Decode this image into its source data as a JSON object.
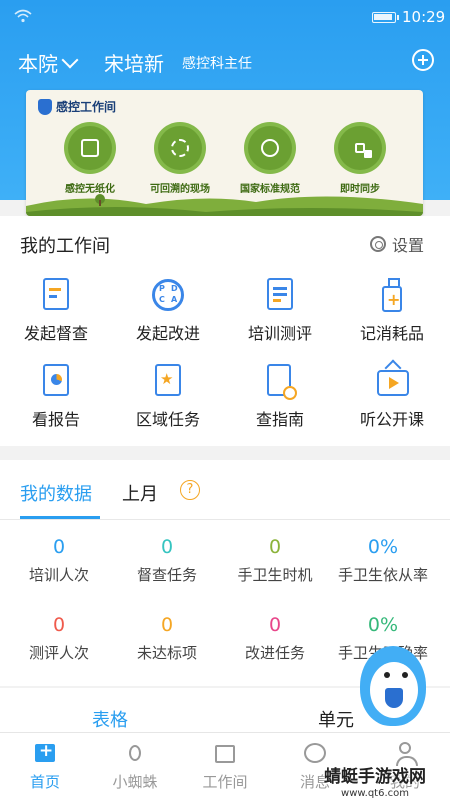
{
  "status_bar": {
    "time": "10:29",
    "wifi_icon": "wifi-icon",
    "battery_icon": "battery-icon"
  },
  "header": {
    "hospital": "本院",
    "user_name": "宋培新",
    "user_role": "感控科主任",
    "add_icon": "plus-circle-icon",
    "bg_color": "#2a9ef0"
  },
  "banner": {
    "title": "感控工作间",
    "items": [
      {
        "label": "感控无纸化",
        "icon": "tablet-icon"
      },
      {
        "label": "可回溯的现场",
        "icon": "refresh-icon"
      },
      {
        "label": "国家标准规范",
        "icon": "medal-icon"
      },
      {
        "label": "即时同步",
        "icon": "sync-icon"
      }
    ]
  },
  "workspace": {
    "title": "我的工作间",
    "settings_label": "设置",
    "items": [
      {
        "label": "发起督查",
        "icon": "edit-document-icon"
      },
      {
        "label": "发起改进",
        "icon": "pdca-icon"
      },
      {
        "label": "培训测评",
        "icon": "checklist-icon"
      },
      {
        "label": "记消耗品",
        "icon": "sanitizer-bottle-icon"
      },
      {
        "label": "看报告",
        "icon": "report-chart-icon"
      },
      {
        "label": "区域任务",
        "icon": "star-flag-icon"
      },
      {
        "label": "查指南",
        "icon": "guide-search-icon"
      },
      {
        "label": "听公开课",
        "icon": "tv-play-icon"
      }
    ]
  },
  "my_data": {
    "tabs": [
      "我的数据",
      "上月"
    ],
    "help_glyph": "?",
    "stats": [
      {
        "value": "0",
        "label": "培训人次",
        "color": "#2a9ef0"
      },
      {
        "value": "0",
        "label": "督查任务",
        "color": "#35c4c0"
      },
      {
        "value": "0",
        "label": "手卫生时机",
        "color": "#8bb33a"
      },
      {
        "value": "0%",
        "label": "手卫生依从率",
        "color": "#2a9ef0"
      },
      {
        "value": "0",
        "label": "测评人次",
        "color": "#ef5a4c"
      },
      {
        "value": "0",
        "label": "未达标项",
        "color": "#f5a623"
      },
      {
        "value": "0",
        "label": "改进任务",
        "color": "#e8468a"
      },
      {
        "value": "0%",
        "label": "手卫生正确率",
        "color": "#35b87a"
      }
    ]
  },
  "table_section": {
    "col1": "表格",
    "col2": "单元"
  },
  "bottom_nav": [
    {
      "label": "首页",
      "icon": "home-icon",
      "active": true
    },
    {
      "label": "小蜘蛛",
      "icon": "spider-icon",
      "active": false
    },
    {
      "label": "工作间",
      "icon": "toolbox-icon",
      "active": false
    },
    {
      "label": "消息",
      "icon": "chat-icon",
      "active": false
    },
    {
      "label": "我的",
      "icon": "user-icon",
      "active": false
    }
  ],
  "watermark": {
    "title": "蜻蜓手游戏网",
    "url": "www.qt6.com"
  }
}
